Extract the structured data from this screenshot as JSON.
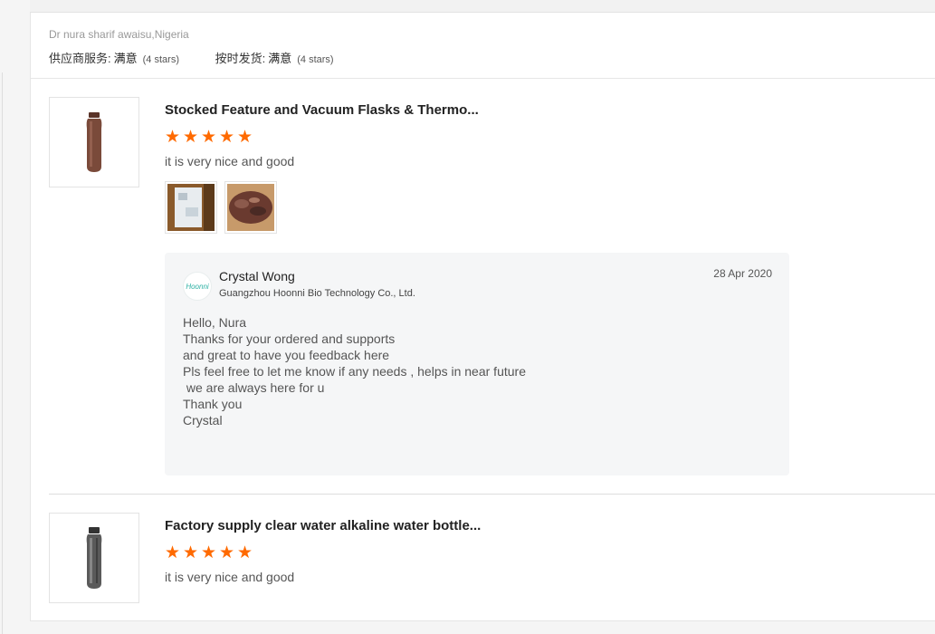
{
  "reviewer": {
    "name": "Dr nura sharif awaisu,Nigeria",
    "ratings": [
      {
        "label": "供应商服务:",
        "value": "满意",
        "stars_text": "(4 stars)"
      },
      {
        "label": "按时发货:",
        "value": "满意",
        "stars_text": "(4 stars)"
      }
    ]
  },
  "products": [
    {
      "title": "Stocked Feature and Vacuum Flasks & Thermo...",
      "stars": 5,
      "comment": "it is very nice and good",
      "thumb_color": "#7a4a3a",
      "photos": 2,
      "reply": {
        "name": "Crystal Wong",
        "company": "Guangzhou Hoonni Bio Technology Co., Ltd.",
        "logo_text": "Hoonni",
        "date": "28 Apr 2020",
        "lines": [
          "Hello, Nura",
          "",
          "Thanks for your ordered and supports",
          "and great to have you feedback here",
          "Pls feel free to let me know if any needs , helps in near future",
          " we are always here for u",
          "",
          "Thank you",
          "Crystal"
        ]
      }
    },
    {
      "title": "Factory supply clear water alkaline water bottle...",
      "stars": 5,
      "comment": "it is very nice and good",
      "thumb_color": "#555555"
    }
  ],
  "colors": {
    "star": "#ff6a00",
    "accent": "#2bb0a3"
  }
}
